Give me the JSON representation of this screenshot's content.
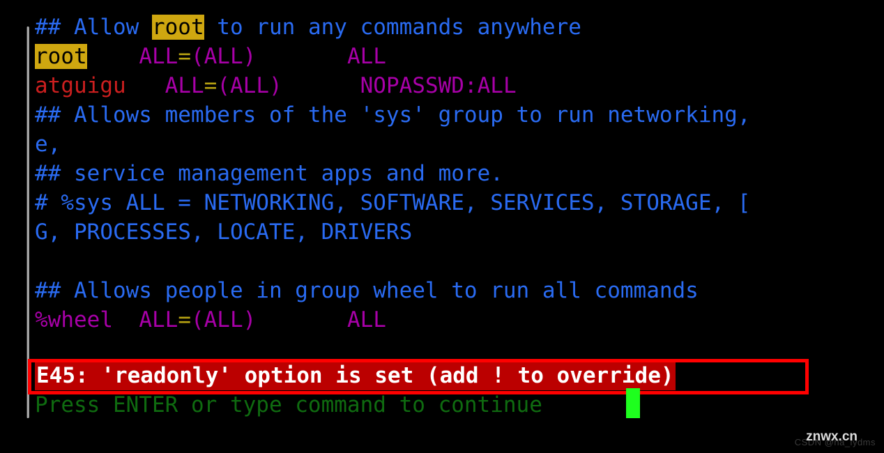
{
  "terminal": {
    "background_color": "#000000",
    "clipped_top_line": "##",
    "lines": [
      {
        "id": "comment-allow-root",
        "segments": [
          {
            "text": "## Allow ",
            "style": "comment"
          },
          {
            "text": "root",
            "style": "highlight"
          },
          {
            "text": " to run any commands anywhere",
            "style": "comment"
          }
        ]
      },
      {
        "id": "rule-root",
        "segments": [
          {
            "text": "root",
            "style": "highlight"
          },
          {
            "text": "    ",
            "style": "plain"
          },
          {
            "text": "ALL",
            "style": "magenta"
          },
          {
            "text": "=",
            "style": "yellow"
          },
          {
            "text": "(ALL)",
            "style": "magenta"
          },
          {
            "text": "       ",
            "style": "plain"
          },
          {
            "text": "ALL",
            "style": "magenta"
          }
        ]
      },
      {
        "id": "rule-atguigu",
        "segments": [
          {
            "text": "atguigu",
            "style": "red"
          },
          {
            "text": "   ",
            "style": "plain"
          },
          {
            "text": "ALL",
            "style": "magenta"
          },
          {
            "text": "=",
            "style": "yellow"
          },
          {
            "text": "(ALL)",
            "style": "magenta"
          },
          {
            "text": "      ",
            "style": "plain"
          },
          {
            "text": "NOPASSWD:ALL",
            "style": "magenta"
          }
        ]
      },
      {
        "id": "comment-sys-group-1",
        "segments": [
          {
            "text": "## Allows members of the 'sys' group to run networking,",
            "style": "comment"
          }
        ]
      },
      {
        "id": "comment-sys-group-wrap",
        "segments": [
          {
            "text": "e,",
            "style": "comment"
          }
        ]
      },
      {
        "id": "comment-service-management",
        "segments": [
          {
            "text": "## service management apps and more.",
            "style": "comment"
          }
        ]
      },
      {
        "id": "comment-sys-rule-1",
        "segments": [
          {
            "text": "# %sys ALL = NETWORKING, SOFTWARE, SERVICES, STORAGE, [",
            "style": "comment"
          }
        ]
      },
      {
        "id": "comment-sys-rule-wrap",
        "segments": [
          {
            "text": "G, PROCESSES, LOCATE, DRIVERS",
            "style": "comment"
          }
        ]
      },
      {
        "id": "blank-line",
        "segments": [
          {
            "text": " ",
            "style": "plain"
          }
        ]
      },
      {
        "id": "comment-wheel-group",
        "segments": [
          {
            "text": "## Allows people in group wheel to run all commands",
            "style": "comment"
          }
        ]
      },
      {
        "id": "rule-wheel",
        "segments": [
          {
            "text": "%wheel",
            "style": "magenta"
          },
          {
            "text": "  ",
            "style": "plain"
          },
          {
            "text": "ALL",
            "style": "magenta"
          },
          {
            "text": "=",
            "style": "yellow"
          },
          {
            "text": "(ALL)",
            "style": "magenta"
          },
          {
            "text": "       ",
            "style": "plain"
          },
          {
            "text": "ALL",
            "style": "magenta"
          }
        ]
      }
    ],
    "error_message": "E45: 'readonly' option is set (add ! to override)",
    "prompt_message": "Press ENTER or type command to continue"
  },
  "annotation": {
    "box_color": "#ff0000",
    "label": "error-highlight-box"
  },
  "cursor": {
    "color": "#1eff1e"
  },
  "colors": {
    "comment": "#2a6bf2",
    "magenta": "#a800a8",
    "red": "#cc1f1f",
    "yellow": "#b8a312",
    "highlight_bg": "#cfa710",
    "error_bg": "#bb0000",
    "error_fg": "#ffffff",
    "prompt_fg": "#0f6b10"
  },
  "watermarks": {
    "csdn": "CSDN @ha_lydms",
    "site": "znwx.cn"
  }
}
